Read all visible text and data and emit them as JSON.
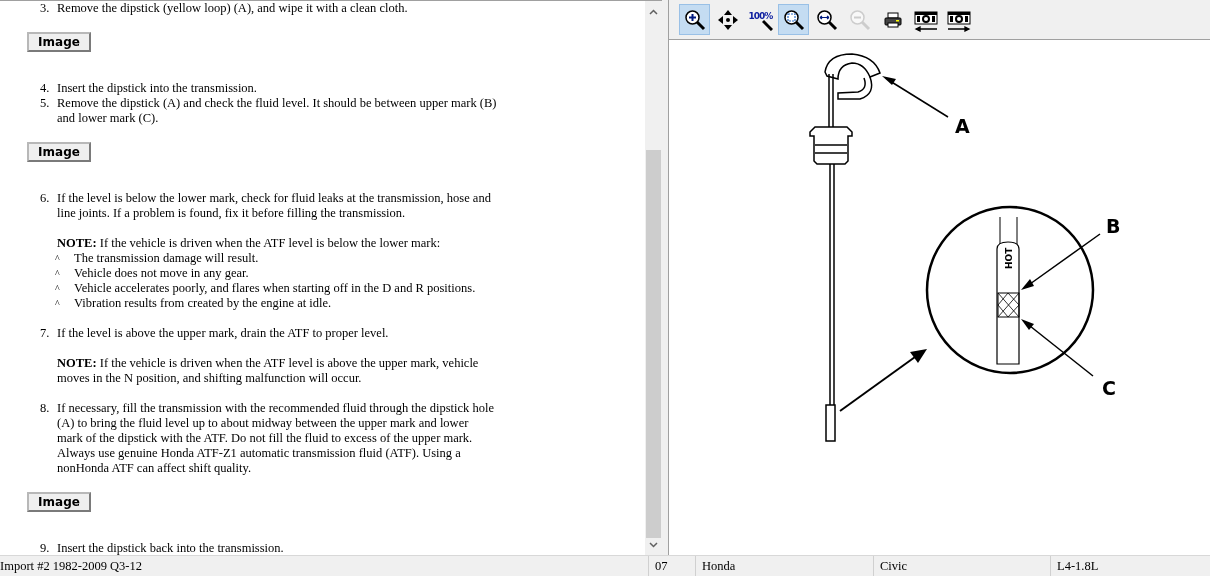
{
  "content": [
    {
      "kind": "step",
      "number": "3.",
      "text": "Remove the dipstick (yellow loop) (A), and wipe it with a clean cloth."
    },
    {
      "kind": "image",
      "label": "Image"
    },
    {
      "kind": "step",
      "number": "4.",
      "text": "Insert the dipstick into the transmission."
    },
    {
      "kind": "step",
      "number": "5.",
      "text": "Remove the dipstick (A) and check the fluid level. It should be between upper mark (B) and lower mark (C)."
    },
    {
      "kind": "image",
      "label": "Image"
    },
    {
      "kind": "step",
      "number": "6.",
      "text": "If the level is below the lower mark, check for fluid leaks at the transmission, hose and line joints. If a problem is found, fix it before filling the transmission."
    },
    {
      "kind": "note",
      "text": "**NOTE:**  If the vehicle is driven when the ATF level is below the lower mark:"
    },
    {
      "kind": "bullet",
      "mark": "^",
      "text": "The transmission damage will result."
    },
    {
      "kind": "bullet",
      "mark": "^",
      "text": "Vehicle does not move in any gear."
    },
    {
      "kind": "bullet",
      "mark": "^",
      "text": "Vehicle accelerates poorly, and flares when starting off in the D and R positions."
    },
    {
      "kind": "bullet",
      "mark": "^",
      "text": "Vibration results from created by the engine at idle."
    },
    {
      "kind": "step",
      "number": "7.",
      "text": "If the level is above the upper mark, drain the ATF to proper level."
    },
    {
      "kind": "note",
      "text": "**NOTE:**  If the vehicle is driven when the ATF level is above the upper mark, vehicle moves in the N position, and shifting malfunction will occur."
    },
    {
      "kind": "step",
      "number": "8.",
      "text": "If necessary, fill the transmission with the recommended fluid through the dipstick hole (A) to bring the fluid level up to about midway between the upper mark and lower mark of the dipstick with the ATF. Do not fill the fluid to excess of the upper mark. Always use genuine Honda ATF-Z1 automatic transmission fluid (ATF). Using a nonHonda ATF can affect shift quality."
    },
    {
      "kind": "image",
      "label": "Image"
    },
    {
      "kind": "step",
      "number": "9.",
      "text": "Insert the dipstick back into the transmission."
    }
  ],
  "viewer": {
    "tools": [
      {
        "kind": "zoom-in",
        "selected": true,
        "disabled": false
      },
      {
        "kind": "pan",
        "selected": false,
        "disabled": false
      },
      {
        "kind": "zoom-100",
        "label": "100%",
        "selected": false,
        "disabled": false
      },
      {
        "kind": "zoom-fit",
        "selected": true,
        "disabled": false
      },
      {
        "kind": "zoom-width",
        "selected": false,
        "disabled": false
      },
      {
        "kind": "zoom-out",
        "selected": false,
        "disabled": true
      },
      {
        "kind": "print",
        "selected": false,
        "disabled": false
      },
      {
        "kind": "prev-image",
        "selected": false,
        "disabled": false
      },
      {
        "kind": "next-image",
        "selected": false,
        "disabled": false
      }
    ],
    "diagram": {
      "callouts": [
        "A",
        "B",
        "C"
      ],
      "marker": "HOT"
    }
  },
  "status_bar": {
    "left": "Import #2 1982-2009 Q3-12",
    "cells": [
      "07",
      "Honda",
      "Civic",
      "L4-1.8L"
    ]
  }
}
